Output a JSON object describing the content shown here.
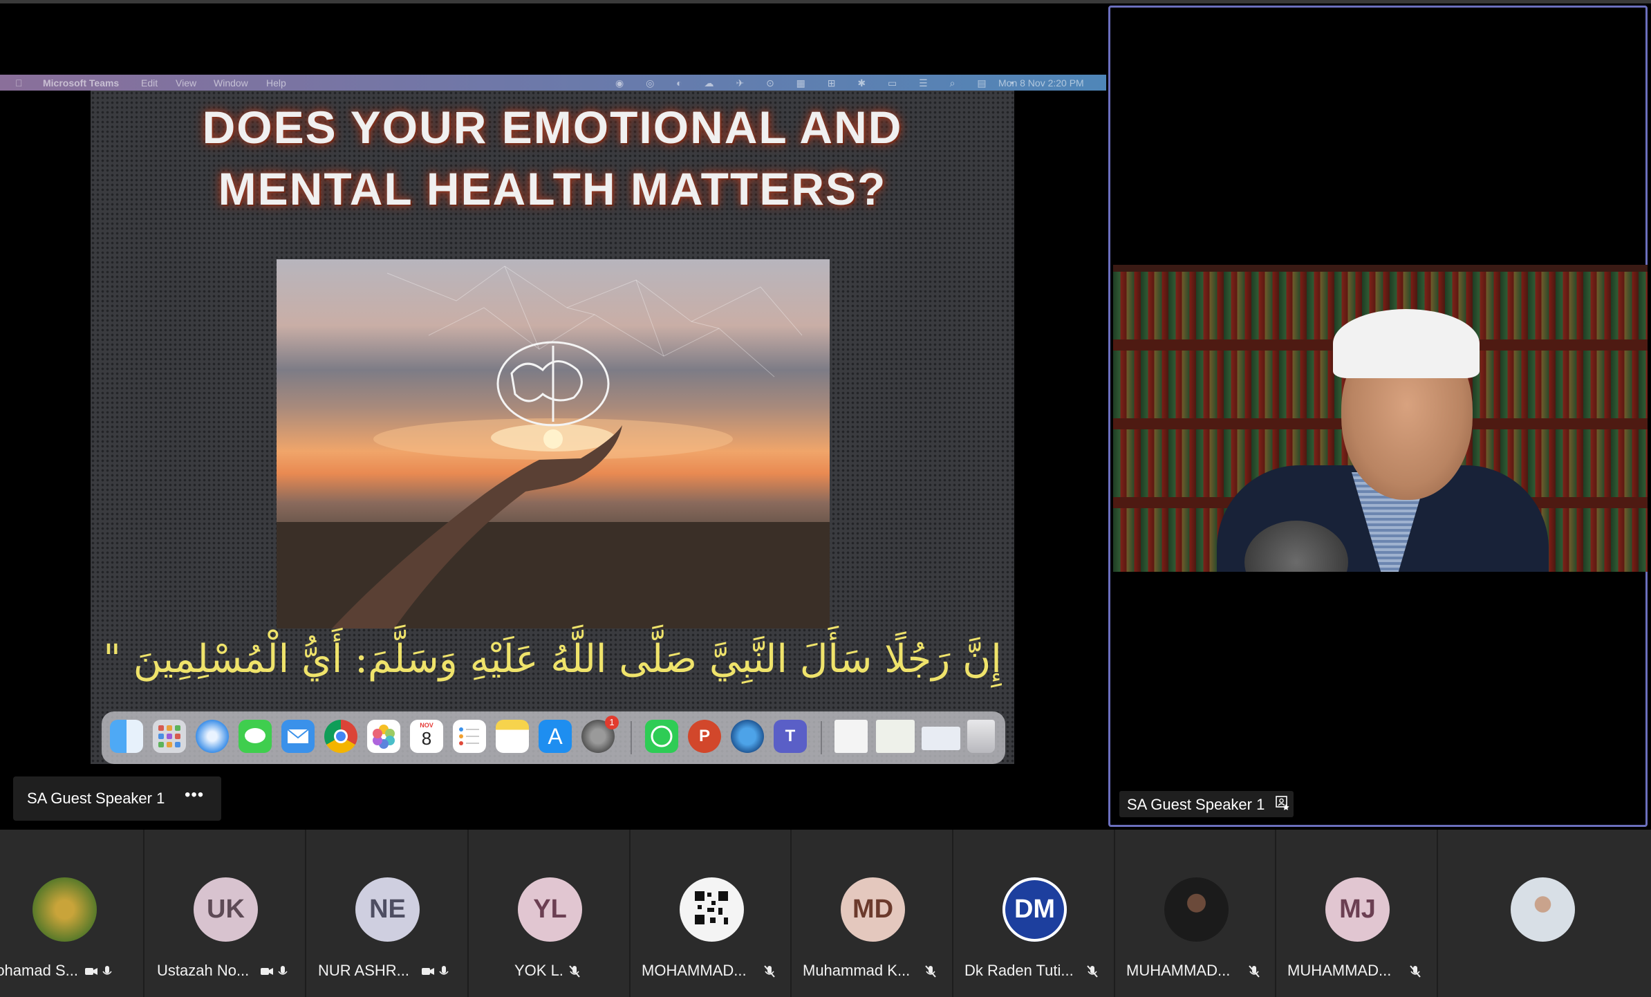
{
  "mac_menubar": {
    "app": "Microsoft Teams",
    "menus": [
      "Edit",
      "View",
      "Window",
      "Help"
    ],
    "clock": "Mon 8 Nov  2:20 PM"
  },
  "slide": {
    "title_line1": "DOES YOUR EMOTIONAL AND",
    "title_line2": "MENTAL HEALTH MATTERS?",
    "arabic_text": "إِنَّ رَجُلًا سَأَلَ النَّبِيَّ صَلَّى اللَّهُ عَلَيْهِ وَسَلَّمَ: أَيُّ الْمُسْلِمِينَ \""
  },
  "dock": {
    "calendar_month": "NOV",
    "calendar_day": "8",
    "settings_badge": "1",
    "apps": [
      "finder-icon",
      "launchpad-icon",
      "safari-icon",
      "messages-icon",
      "mail-icon",
      "chrome-icon",
      "photos-icon",
      "calendar-icon",
      "reminders-icon",
      "notes-icon",
      "app-store-icon",
      "system-preferences-icon",
      "whatsapp-icon",
      "powerpoint-icon",
      "webex-icon",
      "teams-icon",
      "document-icon",
      "spreadsheet-icon",
      "scanner-icon",
      "trash-icon"
    ]
  },
  "shared_screen": {
    "presenter_label": "SA Guest Speaker 1",
    "more_label": "•••"
  },
  "speaker_panel": {
    "name": "SA Guest Speaker 1"
  },
  "participants": [
    {
      "name": "Mohamad S...",
      "initials": "",
      "avatar_color": "#5a7a2a",
      "video_off": true,
      "mic": "on"
    },
    {
      "name": "Ustazah No...",
      "initials": "UK",
      "avatar_color": "#d8c3cf",
      "video_off": true,
      "mic": "on"
    },
    {
      "name": "NUR ASHR...",
      "initials": "NE",
      "avatar_color": "#cfcfe0",
      "video_off": true,
      "mic": "on"
    },
    {
      "name": "YOK L.",
      "initials": "YL",
      "avatar_color": "#e1c6d1",
      "video_off": false,
      "mic": "muted"
    },
    {
      "name": "MOHAMMAD...",
      "initials": "",
      "avatar_color": "#f4f4f4",
      "video_off": false,
      "mic": "muted"
    },
    {
      "name": "Muhammad K...",
      "initials": "MD",
      "avatar_color": "#e4c8be",
      "video_off": false,
      "mic": "muted"
    },
    {
      "name": "Dk Raden Tuti...",
      "initials": "DM",
      "avatar_color": "#1d3f9e",
      "video_off": false,
      "mic": "muted"
    },
    {
      "name": "MUHAMMAD...",
      "initials": "",
      "avatar_color": "#1b1b1b",
      "video_off": false,
      "mic": "muted"
    },
    {
      "name": "MUHAMMAD...",
      "initials": "MJ",
      "avatar_color": "#e1c6d1",
      "video_off": false,
      "mic": "muted"
    },
    {
      "name": "",
      "initials": "",
      "avatar_color": "#d8dfe6",
      "video_off": false,
      "mic": "none"
    }
  ]
}
